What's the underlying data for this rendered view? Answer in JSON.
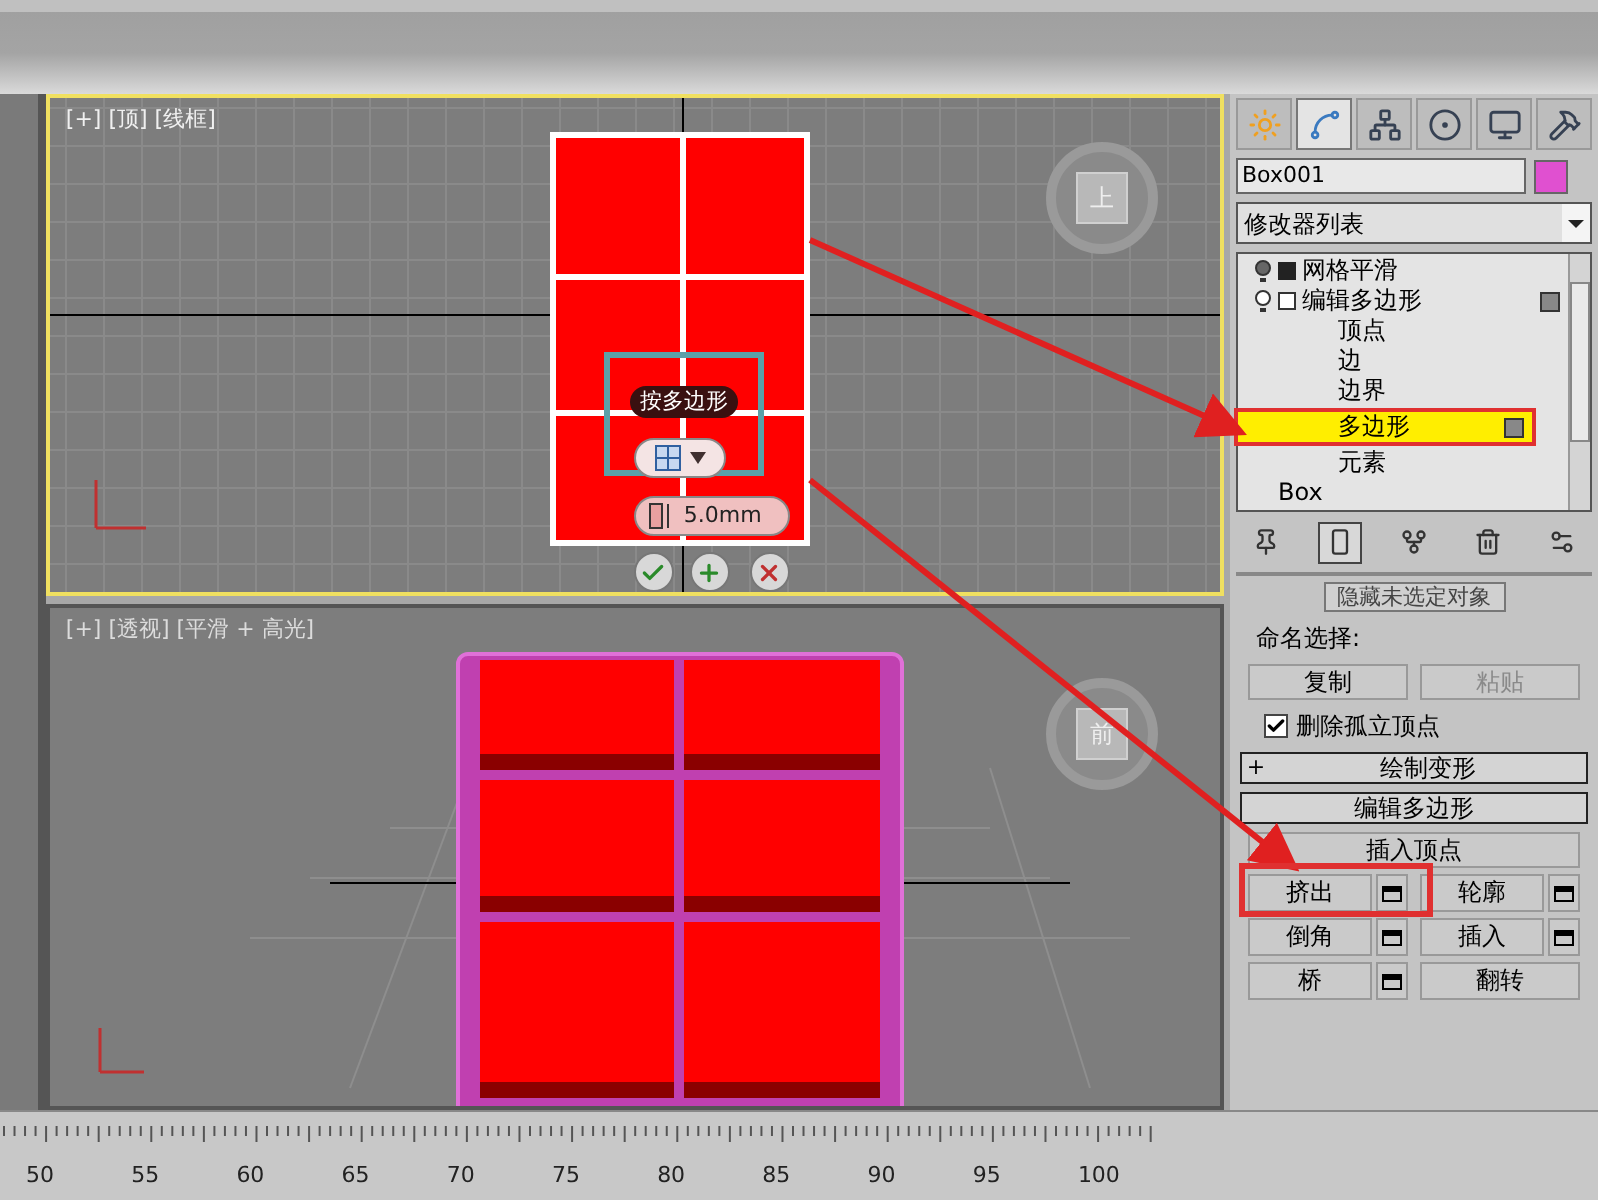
{
  "viewports": [
    {
      "label": "[+] [顶] [线框]",
      "active": true,
      "view_cube": "上"
    },
    {
      "label": "[+] [透视] [平滑 + 高光]",
      "active": false,
      "view_cube": "前"
    }
  ],
  "caddy": {
    "title": "按多边形",
    "value": "5.0mm"
  },
  "command_panel": {
    "tabs": [
      {
        "kind": "create",
        "selected": false
      },
      {
        "kind": "modify",
        "selected": true
      },
      {
        "kind": "hierarchy",
        "selected": false
      },
      {
        "kind": "motion",
        "selected": false
      },
      {
        "kind": "display",
        "selected": false
      },
      {
        "kind": "utilities",
        "selected": false
      }
    ],
    "object_name": "Box001",
    "modifier_list": "修改器列表",
    "stack": [
      {
        "label": "网格平滑",
        "expanded": false
      },
      {
        "label": "编辑多边形",
        "expanded": true,
        "children": [
          {
            "label": "顶点",
            "selected": false
          },
          {
            "label": "边",
            "selected": false
          },
          {
            "label": "边界",
            "selected": false
          },
          {
            "label": "多边形",
            "selected": true
          },
          {
            "label": "元素",
            "selected": false
          }
        ]
      },
      {
        "label": "Box"
      }
    ],
    "stack_toolbar": [
      {
        "kind": "pin",
        "selected": false
      },
      {
        "kind": "end_result",
        "selected": true
      },
      {
        "kind": "unique",
        "selected": false
      },
      {
        "kind": "remove",
        "selected": false
      },
      {
        "kind": "configure",
        "selected": false
      }
    ]
  },
  "selection_rollout": {
    "hide_button": "隐藏未选定对象",
    "named_selection_label": "命名选择:",
    "copy": {
      "label": "复制",
      "disabled": false
    },
    "paste": {
      "label": "粘贴",
      "disabled": true
    },
    "checkbox": {
      "label": "删除孤立顶点",
      "checked": true
    }
  },
  "rollouts": [
    {
      "title": "绘制变形",
      "sign": "+"
    },
    {
      "title": "编辑多边形"
    }
  ],
  "edit_buttons": [
    {
      "label": "插入顶点",
      "kind": "wide"
    },
    {
      "label": "挤出",
      "kind": "settings"
    },
    {
      "label": "轮廓",
      "kind": "settings"
    },
    {
      "label": "倒角",
      "kind": "settings"
    },
    {
      "label": "插入",
      "kind": "settings"
    },
    {
      "label": "桥",
      "kind": "settings"
    },
    {
      "label": "翻转",
      "kind": "plain"
    }
  ],
  "ruler": {
    "ticks": [
      "50",
      "55",
      "60",
      "65",
      "70",
      "75",
      "80",
      "85",
      "90",
      "95",
      "100"
    ]
  }
}
